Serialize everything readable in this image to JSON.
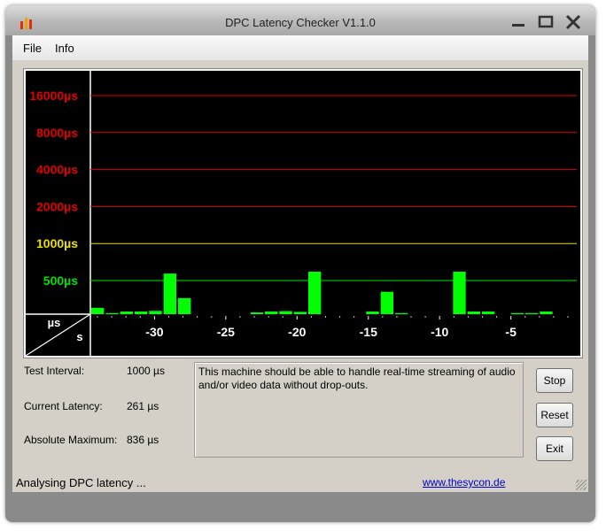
{
  "window": {
    "title": "DPC Latency Checker V1.1.0"
  },
  "menu": {
    "items": [
      "File",
      "Info"
    ]
  },
  "chart_data": {
    "type": "bar",
    "y_scale": "log2",
    "y_unit": "µs",
    "x_unit": "s",
    "threshold_lines": [
      {
        "label": "16000µs",
        "value": 16000,
        "color": "#e00000"
      },
      {
        "label": "8000µs",
        "value": 8000,
        "color": "#e00000"
      },
      {
        "label": "4000µs",
        "value": 4000,
        "color": "#e00000"
      },
      {
        "label": "2000µs",
        "value": 2000,
        "color": "#e00000"
      },
      {
        "label": "1000µs",
        "value": 1000,
        "color": "#e8e000"
      },
      {
        "label": "500µs",
        "value": 500,
        "color": "#00e000"
      }
    ],
    "axis_unit_y": "µs",
    "axis_unit_x": "s",
    "x_ticks": [
      -30,
      -25,
      -20,
      -15,
      -10,
      -5
    ],
    "x_range": [
      -34.5,
      -1
    ],
    "bar_color": "#00ff00",
    "values": [
      300,
      272,
      280,
      280,
      283,
      570,
      360,
      260,
      240,
      235,
      255,
      275,
      280,
      282,
      278,
      590,
      260,
      255,
      265,
      280,
      405,
      272,
      260,
      255,
      250,
      590,
      280,
      280,
      266,
      272,
      272,
      280,
      255
    ]
  },
  "stats": {
    "test_interval_label": "Test Interval:",
    "test_interval_value": "1000 µs",
    "current_latency_label": "Current Latency:",
    "current_latency_value": "261 µs",
    "absolute_maximum_label": "Absolute Maximum:",
    "absolute_maximum_value": "836 µs"
  },
  "message": "This machine should be able to handle real-time streaming of audio and/or video data without drop-outs.",
  "buttons": {
    "stop": "Stop",
    "reset": "Reset",
    "exit": "Exit"
  },
  "status": {
    "text": "Analysing DPC latency ...",
    "link": "www.thesycon.de"
  },
  "colors": {
    "title_bar": "#b8b8b8",
    "panel": "#d4d0c8",
    "link": "#0000cc"
  },
  "icons": [
    "app-icon",
    "minimize-icon",
    "maximize-icon",
    "close-icon",
    "resize-grip-icon"
  ]
}
